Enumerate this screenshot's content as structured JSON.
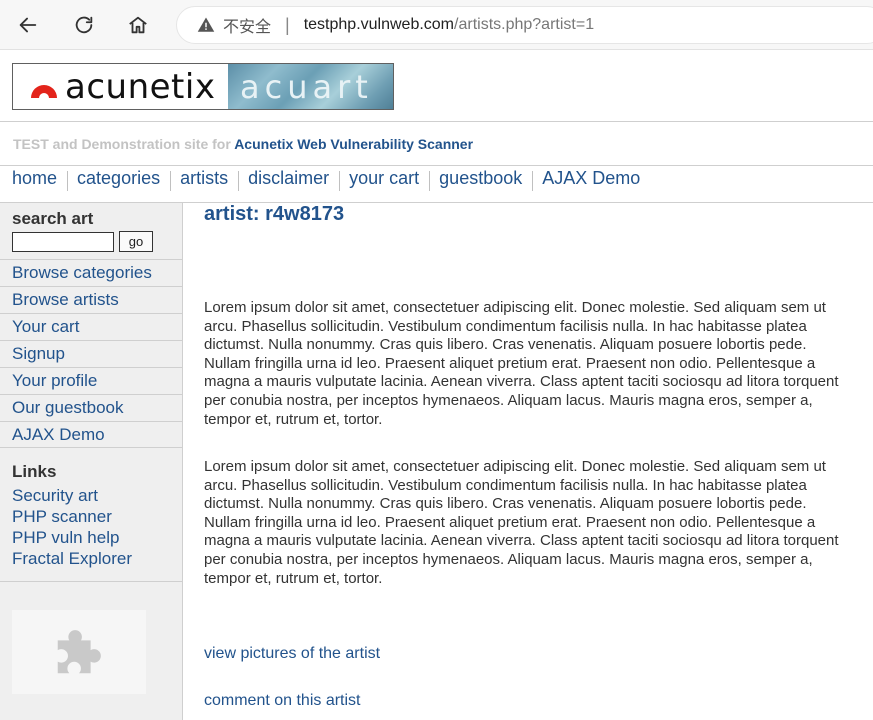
{
  "browser": {
    "insecure_label": "不安全",
    "separator": "|",
    "url_host": "testphp.vulnweb.com",
    "url_path": "/artists.php?artist=1"
  },
  "header": {
    "logo_left": "acunetix",
    "logo_right": "acuart",
    "tagline_prefix": "TEST and Demonstration site for",
    "tagline_product": "Acunetix Web Vulnerability Scanner"
  },
  "topnav": {
    "items": [
      "home",
      "categories",
      "artists",
      "disclaimer",
      "your cart",
      "guestbook",
      "AJAX Demo"
    ]
  },
  "sidebar": {
    "search_title": "search art",
    "search_value": "",
    "go_label": "go",
    "menu": [
      "Browse categories",
      "Browse artists",
      "Your cart",
      "Signup",
      "Your profile",
      "Our guestbook",
      "AJAX Demo"
    ],
    "links_title": "Links",
    "links": [
      "Security art",
      "PHP scanner",
      "PHP vuln help",
      "Fractal Explorer"
    ]
  },
  "main": {
    "heading": "artist: r4w8173",
    "paragraph1": "Lorem ipsum dolor sit amet, consectetuer adipiscing elit. Donec molestie. Sed aliquam sem ut arcu. Phasellus sollicitudin. Vestibulum condimentum facilisis nulla. In hac habitasse platea dictumst. Nulla nonummy. Cras quis libero. Cras venenatis. Aliquam posuere lobortis pede. Nullam fringilla urna id leo. Praesent aliquet pretium erat. Praesent non odio. Pellentesque a magna a mauris vulputate lacinia. Aenean viverra. Class aptent taciti sociosqu ad litora torquent per conubia nostra, per inceptos hymenaeos. Aliquam lacus. Mauris magna eros, semper a, tempor et, rutrum et, tortor.",
    "paragraph2": "Lorem ipsum dolor sit amet, consectetuer adipiscing elit. Donec molestie. Sed aliquam sem ut arcu. Phasellus sollicitudin. Vestibulum condimentum facilisis nulla. In hac habitasse platea dictumst. Nulla nonummy. Cras quis libero. Cras venenatis. Aliquam posuere lobortis pede. Nullam fringilla urna id leo. Praesent aliquet pretium erat. Praesent non odio. Pellentesque a magna a mauris vulputate lacinia. Aenean viverra. Class aptent taciti sociosqu ad litora torquent per conubia nostra, per inceptos hymenaeos. Aliquam lacus. Mauris magna eros, semper a, tempor et, rutrum et, tortor.",
    "link_pictures": "view pictures of the artist",
    "link_comment": "comment on this artist"
  },
  "icons": {
    "back": "back-arrow-icon",
    "reload": "reload-icon",
    "home": "home-icon",
    "warning": "warning-icon",
    "plugin": "puzzle-icon"
  },
  "colors": {
    "link": "#22538c",
    "tagline_grey": "#c3c3c3",
    "sidebar_bg": "#efefef"
  }
}
